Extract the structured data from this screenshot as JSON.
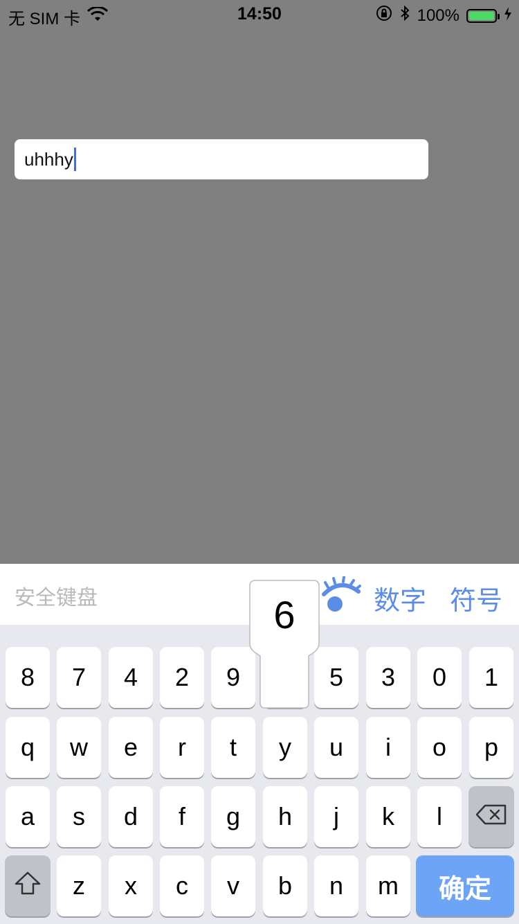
{
  "status_bar": {
    "carrier": "无 SIM 卡",
    "time": "14:50",
    "battery_percent": "100%",
    "wifi_icon": "wifi-icon",
    "orientation_lock_icon": "orientation-lock-icon",
    "bluetooth_icon": "bluetooth-icon",
    "charging_icon": "charging-bolt-icon",
    "battery_level": 1.0,
    "battery_color": "#4cd964"
  },
  "input": {
    "value": "uhhhy",
    "caret_color": "#3a6fe8"
  },
  "keyboard": {
    "title": "安全键盘",
    "eye_icon": "eye-toggle-icon",
    "mode_number": "数字",
    "mode_symbol": "符号",
    "accent_color": "#5b8de8",
    "popup_key": "6",
    "row1": [
      "8",
      "7",
      "4",
      "2",
      "9",
      "",
      "5",
      "3",
      "0",
      "1"
    ],
    "row2": [
      "q",
      "w",
      "e",
      "r",
      "t",
      "y",
      "u",
      "i",
      "o",
      "p"
    ],
    "row3": [
      "a",
      "s",
      "d",
      "f",
      "g",
      "h",
      "j",
      "k",
      "l"
    ],
    "row4": [
      "z",
      "x",
      "c",
      "v",
      "b",
      "n",
      "m"
    ],
    "shift_icon": "shift-arrow-icon",
    "delete_icon": "backspace-icon",
    "confirm_label": "确定",
    "confirm_color": "#6ea4f6"
  }
}
